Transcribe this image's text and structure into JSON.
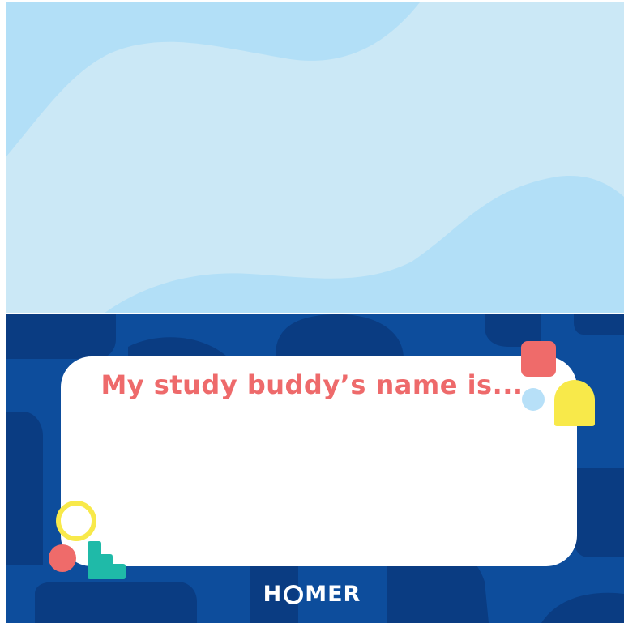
{
  "card": {
    "headline": "My study buddy’s name is..."
  },
  "logo": {
    "text_before_o": "H",
    "text_after_o": "MER",
    "full_name": "HOMER"
  },
  "colors": {
    "sky_light": "#cbe8f6",
    "sky_wave": "#b2dff7",
    "sea_base": "#0d4d9c",
    "sea_shape": "#0a3c82",
    "headline": "#ee6a6b",
    "coral": "#ef6b6a",
    "light_blue_dot": "#b7e0f8",
    "yellow": "#f8e94a",
    "teal": "#1fbaa8"
  },
  "decorations": [
    "coral-square-icon",
    "light-blue-circle-icon",
    "yellow-arch-icon",
    "yellow-ring-icon",
    "coral-circle-icon",
    "teal-steps-icon"
  ]
}
